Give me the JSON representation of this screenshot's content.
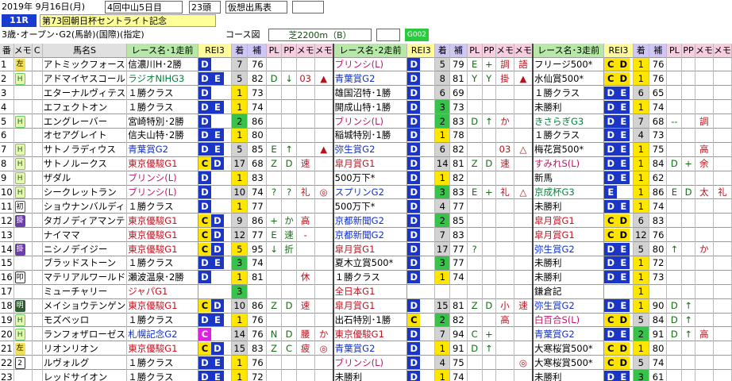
{
  "header": {
    "date": "2019年 9月16日(月)",
    "meet": "4回中山5日目",
    "runners": "23頭",
    "mode": "仮想出馬表",
    "race_no": "11R",
    "title": "第73回朝日杯セントライト記念",
    "cond": "3歳･オープン･G2(馬齢)(国際)(指定)",
    "course_label": "コース図",
    "course": "芝2200m（B）",
    "grade": "G002"
  },
  "columns": {
    "ban": "番",
    "memo": "メモ",
    "c": "C",
    "name": "馬名S",
    "r1": "レース名･1走前",
    "rc": "REI3",
    "chaku": "着",
    "ho": "補",
    "pl": "PL",
    "pp": "PP",
    "me": "メモ",
    "me2": "メモ",
    "r2": "レース名･2走前",
    "r3": "レース名･3走前"
  },
  "rows": [
    {
      "no": "1",
      "mk": "左",
      "mkc": "left",
      "name": "アトミックフォース",
      "r1": "信濃川H･2勝",
      "r1c": "rdone",
      "rc1": "D",
      "rc1b": "r3",
      "rc1e": "",
      "rk1": "7",
      "rk1c": "rkg",
      "ho1": "76",
      "pl1": "",
      "pp1": "",
      "me1a": "",
      "me1b": "",
      "r2": "ブリンシ(L)",
      "r2c": "rpink",
      "rc2": "D",
      "rc2b": "r3",
      "rk2": "5",
      "rk2c": "rkg",
      "ho2": "79",
      "pl2": "E",
      "pp2": "+",
      "me2a": "調",
      "me2b": "語",
      "r3": "フリージ500*",
      "r3c": "rdone",
      "rc3": "C",
      "rc3b": "D",
      "rk3": "1",
      "rk3c": "rk1",
      "ho3": "76",
      "pl3": "",
      "pp3": "",
      "me3a": "",
      "me3b": ""
    },
    {
      "no": "2",
      "mk": "H",
      "mkc": "h",
      "name": "アドマイヤスコール",
      "r1": "ラジオNIHG3",
      "r1c": "rgreen",
      "rc1": "D",
      "rc1b": "r3",
      "rc1e": "E",
      "rk1": "5",
      "rk1c": "rkg",
      "ho1": "82",
      "pl1": "D",
      "pp1": "↓",
      "me1a": "03",
      "me1b": "▲",
      "r2": "青葉賞G2",
      "r2c": "rblue",
      "rc2": "D",
      "rc2b": "r3",
      "rk2": "8",
      "rk2c": "rkg",
      "ho2": "81",
      "pl2": "Y",
      "pp2": "Y",
      "me2a": "掛",
      "me2b": "▲",
      "r3": "水仙賞500*",
      "r3c": "rdone",
      "rc3": "C",
      "rc3b": "D",
      "rk3": "1",
      "rk3c": "rk1",
      "ho3": "76",
      "pl3": "",
      "pp3": "",
      "me3a": "",
      "me3b": ""
    },
    {
      "no": "3",
      "mk": "",
      "mkc": "none",
      "name": "エターナルヴィテス",
      "r1": "１勝クラス",
      "r1c": "rdone",
      "rc1": "D",
      "rc1b": "r3",
      "rc1e": "",
      "rk1": "1",
      "rk1c": "rk1",
      "ho1": "73",
      "pl1": "",
      "pp1": "",
      "me1a": "",
      "me1b": "",
      "r2": "雄国沼特･1勝",
      "r2c": "rdone",
      "rc2": "D",
      "rc2b": "r3",
      "rk2": "6",
      "rk2c": "rkg",
      "ho2": "69",
      "pl2": "",
      "pp2": "",
      "me2a": "",
      "me2b": "",
      "r3": "１勝クラス",
      "r3c": "rdone",
      "rc3": "D",
      "rc3b": "E",
      "rk3": "6",
      "rk3c": "rkg",
      "ho3": "65",
      "pl3": "",
      "pp3": "",
      "me3a": "",
      "me3b": ""
    },
    {
      "no": "4",
      "mk": "",
      "mkc": "none",
      "name": "エフェクトオン",
      "r1": "１勝クラス",
      "r1c": "rdone",
      "rc1": "D",
      "rc1b": "r3",
      "rc1e": "E",
      "rk1": "1",
      "rk1c": "rk1",
      "ho1": "74",
      "pl1": "",
      "pp1": "",
      "me1a": "",
      "me1b": "",
      "r2": "開成山特･1勝",
      "r2c": "rdone",
      "rc2": "D",
      "rc2b": "r3",
      "rk2": "3",
      "rk2c": "rk3",
      "ho2": "73",
      "pl2": "",
      "pp2": "",
      "me2a": "",
      "me2b": "",
      "r3": "未勝利",
      "r3c": "rdone",
      "rc3": "D",
      "rc3b": "E",
      "rk3": "1",
      "rk3c": "rk1",
      "ho3": "74",
      "pl3": "",
      "pp3": "",
      "me3a": "",
      "me3b": ""
    },
    {
      "no": "5",
      "mk": "H",
      "mkc": "h",
      "name": "エングレーバー",
      "r1": "宮崎特別･2勝",
      "r1c": "rdone",
      "rc1": "D",
      "rc1b": "r3",
      "rc1e": "",
      "rk1": "2",
      "rk1c": "rk2",
      "ho1": "86",
      "pl1": "",
      "pp1": "",
      "me1a": "",
      "me1b": "",
      "r2": "ブリンシ(L)",
      "r2c": "rpink",
      "rc2": "D",
      "rc2b": "r3",
      "rk2": "2",
      "rk2c": "rk2",
      "ho2": "83",
      "pl2": "D",
      "pp2": "↑",
      "me2a": "か",
      "me2b": "",
      "r3": "きさらぎG3",
      "r3c": "rgreen",
      "rc3": "D",
      "rc3b": "E",
      "rk3": "7",
      "rk3c": "rkg",
      "ho3": "68",
      "pl3": "--",
      "pp3": "",
      "me3a": "調",
      "me3b": ""
    },
    {
      "no": "6",
      "mk": "",
      "mkc": "none",
      "name": "オセアグレイト",
      "r1": "信夫山特･2勝",
      "r1c": "rdone",
      "rc1": "D",
      "rc1b": "r3",
      "rc1e": "E",
      "rk1": "1",
      "rk1c": "rk1",
      "ho1": "80",
      "pl1": "",
      "pp1": "",
      "me1a": "",
      "me1b": "",
      "r2": "稲城特別･1勝",
      "r2c": "rdone",
      "rc2": "D",
      "rc2b": "r3",
      "rk2": "1",
      "rk2c": "rk1",
      "ho2": "78",
      "pl2": "",
      "pp2": "",
      "me2a": "",
      "me2b": "",
      "r3": "１勝クラス",
      "r3c": "rdone",
      "rc3": "D",
      "rc3b": "E",
      "rk3": "4",
      "rk3c": "rkg",
      "ho3": "73",
      "pl3": "",
      "pp3": "",
      "me3a": "",
      "me3b": ""
    },
    {
      "no": "7",
      "mk": "H",
      "mkc": "h",
      "name": "サトノラディウス",
      "r1": "青葉賞G2",
      "r1c": "rblue",
      "rc1": "D",
      "rc1b": "r3",
      "rc1e": "E",
      "rk1": "5",
      "rk1c": "rkg",
      "ho1": "85",
      "pl1": "E",
      "pp1": "↑",
      "me1a": "",
      "me1b": "▲",
      "r2": "弥生賞G2",
      "r2c": "rblue",
      "rc2": "D",
      "rc2b": "r3",
      "rk2": "6",
      "rk2c": "rkg",
      "ho2": "82",
      "pl2": "",
      "pp2": "",
      "me2a": "03",
      "me2b": "△",
      "r3": "梅花賞500*",
      "r3c": "rdone",
      "rc3": "D",
      "rc3b": "E",
      "rk3": "1",
      "rk3c": "rk1",
      "ho3": "75",
      "pl3": "",
      "pp3": "",
      "me3a": "高",
      "me3b": ""
    },
    {
      "no": "8",
      "mk": "H",
      "mkc": "h",
      "name": "サトノルークス",
      "r1": "東京優駿G1",
      "r1c": "rred",
      "rc1": "C",
      "rc1b": "r3y",
      "rc1e": "D",
      "rk1": "17",
      "rk1c": "rkg",
      "ho1": "68",
      "pl1": "Z",
      "pp1": "D",
      "me1a": "速",
      "me1b": "",
      "r2": "皐月賞G1",
      "r2c": "rred",
      "rc2": "D",
      "rc2b": "r3",
      "rk2": "14",
      "rk2c": "rkg",
      "ho2": "81",
      "pl2": "Z",
      "pp2": "D",
      "me2a": "速",
      "me2b": "",
      "r3": "すみれS(L)",
      "r3c": "rpink",
      "rc3": "D",
      "rc3b": "E",
      "rk3": "1",
      "rk3c": "rk1",
      "ho3": "84",
      "pl3": "D",
      "pp3": "+",
      "me3a": "余",
      "me3b": ""
    },
    {
      "no": "9",
      "mk": "H",
      "mkc": "h",
      "name": "ザダル",
      "r1": "ブリンシ(L)",
      "r1c": "rpink",
      "rc1": "D",
      "rc1b": "r3",
      "rc1e": "",
      "rk1": "1",
      "rk1c": "rk1",
      "ho1": "83",
      "pl1": "",
      "pp1": "",
      "me1a": "",
      "me1b": "",
      "r2": "500万下*",
      "r2c": "rdone",
      "rc2": "D",
      "rc2b": "r3",
      "rk2": "1",
      "rk2c": "rk1",
      "ho2": "82",
      "pl2": "",
      "pp2": "",
      "me2a": "",
      "me2b": "",
      "r3": "新馬",
      "r3c": "rdone",
      "rc3": "D",
      "rc3b": "E",
      "rk3": "1",
      "rk3c": "rk1",
      "ho3": "62",
      "pl3": "",
      "pp3": "",
      "me3a": "",
      "me3b": ""
    },
    {
      "no": "10",
      "mk": "H",
      "mkc": "h",
      "name": "シークレットラン",
      "r1": "ブリンシ(L)",
      "r1c": "rpink",
      "rc1": "D",
      "rc1b": "r3",
      "rc1e": "",
      "rk1": "10",
      "rk1c": "rkg",
      "ho1": "74",
      "pl1": "?",
      "pp1": "?",
      "me1a": "礼",
      "me1b": "◎",
      "r2": "スプリンG2",
      "r2c": "rblue",
      "rc2": "D",
      "rc2b": "r3",
      "rk2": "3",
      "rk2c": "rk3",
      "ho2": "83",
      "pl2": "E",
      "pp2": "+",
      "me2a": "礼",
      "me2b": "△",
      "r3": "京成杯G3",
      "r3c": "rgreen",
      "rc3": "E",
      "rc3b": "",
      "rk3": "1",
      "rk3c": "rk1",
      "ho3": "86",
      "pl3": "E",
      "pp3": "D",
      "me3a": "太",
      "me3b": "礼"
    },
    {
      "no": "11",
      "mk": "初",
      "mkc": "first",
      "name": "ショウナンバルディ",
      "r1": "１勝クラス",
      "r1c": "rdone",
      "rc1": "D",
      "rc1b": "r3",
      "rc1e": "",
      "rk1": "1",
      "rk1c": "rk1",
      "ho1": "77",
      "pl1": "",
      "pp1": "",
      "me1a": "",
      "me1b": "",
      "r2": "500万下*",
      "r2c": "rdone",
      "rc2": "D",
      "rc2b": "r3",
      "rk2": "4",
      "rk2c": "rkg",
      "ho2": "77",
      "pl2": "",
      "pp2": "",
      "me2a": "",
      "me2b": "",
      "r3": "未勝利",
      "r3c": "rdone",
      "rc3": "D",
      "rc3b": "E",
      "rk3": "1",
      "rk3c": "rk1",
      "ho3": "74",
      "pl3": "",
      "pp3": "",
      "me3a": "",
      "me3b": ""
    },
    {
      "no": "12",
      "mk": "掛",
      "mkc": "block",
      "name": "タガノディアマンテ",
      "r1": "東京優駿G1",
      "r1c": "rred",
      "rc1": "C",
      "rc1b": "r3y",
      "rc1e": "D",
      "rk1": "9",
      "rk1c": "rkg",
      "ho1": "86",
      "pl1": "+",
      "pp1": "か",
      "me1a": "高",
      "me1b": "",
      "r2": "京都新聞G2",
      "r2c": "rblue",
      "rc2": "D",
      "rc2b": "r3",
      "rk2": "2",
      "rk2c": "rk2",
      "ho2": "85",
      "pl2": "",
      "pp2": "",
      "me2a": "",
      "me2b": "",
      "r3": "皐月賞G1",
      "r3c": "rred",
      "rc3": "C",
      "rc3b": "D",
      "rk3": "6",
      "rk3c": "rkg",
      "ho3": "83",
      "pl3": "",
      "pp3": "",
      "me3a": "",
      "me3b": ""
    },
    {
      "no": "13",
      "mk": "",
      "mkc": "none",
      "name": "ナイママ",
      "r1": "東京優駿G1",
      "r1c": "rred",
      "rc1": "C",
      "rc1b": "r3y",
      "rc1e": "D",
      "rk1": "12",
      "rk1c": "rkg",
      "ho1": "77",
      "pl1": "E",
      "pp1": "速",
      "me1a": "-",
      "me1b": "",
      "r2": "京都新聞G2",
      "r2c": "rblue",
      "rc2": "D",
      "rc2b": "r3",
      "rk2": "7",
      "rk2c": "rkg",
      "ho2": "83",
      "pl2": "",
      "pp2": "",
      "me2a": "",
      "me2b": "",
      "r3": "皐月賞G1",
      "r3c": "rred",
      "rc3": "C",
      "rc3b": "D",
      "rk3": "12",
      "rk3c": "rkg",
      "ho3": "76",
      "pl3": "",
      "pp3": "",
      "me3a": "",
      "me3b": ""
    },
    {
      "no": "14",
      "mk": "掛",
      "mkc": "block",
      "name": "ニシノデイジー",
      "r1": "東京優駿G1",
      "r1c": "rred",
      "rc1": "C",
      "rc1b": "r3y",
      "rc1e": "D",
      "rk1": "5",
      "rk1c": "rk1",
      "ho1": "95",
      "pl1": "↓",
      "pp1": "折",
      "me1a": "",
      "me1b": "",
      "r2": "皐月賞G1",
      "r2c": "rred",
      "rc2": "D",
      "rc2b": "r3",
      "rk2": "17",
      "rk2c": "rkg",
      "ho2": "77",
      "pl2": "?",
      "pp2": "",
      "me2a": "",
      "me2b": "",
      "r3": "弥生賞G2",
      "r3c": "rblue",
      "rc3": "D",
      "rc3b": "E",
      "rk3": "5",
      "rk3c": "rkg",
      "ho3": "80",
      "pl3": "↑",
      "pp3": "",
      "me3a": "か",
      "me3b": ""
    },
    {
      "no": "15",
      "mk": "",
      "mkc": "none",
      "name": "ブラッドストーン",
      "r1": "１勝クラス",
      "r1c": "rdone",
      "rc1": "D",
      "rc1b": "r3",
      "rc1e": "E",
      "rk1": "3",
      "rk1c": "rk3",
      "ho1": "74",
      "pl1": "",
      "pp1": "",
      "me1a": "",
      "me1b": "",
      "r2": "夏木立賞500*",
      "r2c": "rdone",
      "rc2": "D",
      "rc2b": "r3",
      "rk2": "3",
      "rk2c": "rk3",
      "ho2": "77",
      "pl2": "",
      "pp2": "",
      "me2a": "",
      "me2b": "",
      "r3": "未勝利",
      "r3c": "rdone",
      "rc3": "D",
      "rc3b": "E",
      "rk3": "1",
      "rk3c": "rk1",
      "ho3": "72",
      "pl3": "",
      "pp3": "",
      "me3a": "",
      "me3b": ""
    },
    {
      "no": "16",
      "mk": "叩",
      "mkc": "ttl",
      "name": "マテリアルワールド",
      "r1": "瀬波温泉･2勝",
      "r1c": "rdone",
      "rc1": "D",
      "rc1b": "r3",
      "rc1e": "",
      "rk1": "1",
      "rk1c": "rk1",
      "ho1": "81",
      "pl1": "",
      "pp1": "",
      "me1a": "休",
      "me1b": "",
      "r2": "１勝クラス",
      "r2c": "rdone",
      "rc2": "D",
      "rc2b": "r3",
      "rk2": "1",
      "rk2c": "rk1",
      "ho2": "74",
      "pl2": "",
      "pp2": "",
      "me2a": "",
      "me2b": "",
      "r3": "未勝利",
      "r3c": "rdone",
      "rc3": "D",
      "rc3b": "E",
      "rk3": "1",
      "rk3c": "rk1",
      "ho3": "73",
      "pl3": "",
      "pp3": "",
      "me3a": "",
      "me3b": ""
    },
    {
      "no": "17",
      "mk": "",
      "mkc": "none",
      "name": "ミューチャリー",
      "r1": "ジャパG1",
      "r1c": "rred",
      "rc1": "",
      "rc1b": "",
      "rc1e": "",
      "rk1": "3",
      "rk1c": "rk3",
      "ho1": "",
      "pl1": "",
      "pp1": "",
      "me1a": "",
      "me1b": "",
      "r2": "全日本G1",
      "r2c": "rred",
      "rc2": "",
      "rc2b": "",
      "rk2": "",
      "rk2c": "",
      "ho2": "",
      "pl2": "",
      "pp2": "",
      "me2a": "",
      "me2b": "",
      "r3": "鎌倉記",
      "r3c": "rdone",
      "rc3": "",
      "rc3b": "",
      "rk3": "1",
      "rk3c": "rk1",
      "ho3": "",
      "pl3": "",
      "pp3": "",
      "me3a": "",
      "me3b": ""
    },
    {
      "no": "18",
      "mk": "明",
      "mkc": "blinker",
      "name": "メイショウテンゲン",
      "r1": "東京優駿G1",
      "r1c": "rred",
      "rc1": "C",
      "rc1b": "r3y",
      "rc1e": "D",
      "rk1": "10",
      "rk1c": "rkg",
      "ho1": "86",
      "pl1": "Z",
      "pp1": "D",
      "me1a": "速",
      "me1b": "",
      "r2": "皐月賞G1",
      "r2c": "rred",
      "rc2": "D",
      "rc2b": "r3",
      "rk2": "15",
      "rk2c": "rkg",
      "ho2": "81",
      "pl2": "Z",
      "pp2": "D",
      "me2a": "小",
      "me2b": "速",
      "r3": "弥生賞G2",
      "r3c": "rblue",
      "rc3": "D",
      "rc3b": "E",
      "rk3": "1",
      "rk3c": "rk1",
      "ho3": "90",
      "pl3": "D",
      "pp3": "↑",
      "me3a": "",
      "me3b": ""
    },
    {
      "no": "19",
      "mk": "H",
      "mkc": "h",
      "name": "モズベッロ",
      "r1": "１勝クラス",
      "r1c": "rdone",
      "rc1": "D",
      "rc1b": "r3",
      "rc1e": "E",
      "rk1": "1",
      "rk1c": "rk1",
      "ho1": "76",
      "pl1": "",
      "pp1": "",
      "me1a": "",
      "me1b": "",
      "r2": "出石特別･1勝",
      "r2c": "rdone",
      "rc2": "C",
      "rc2b": "r3y",
      "rk2": "2",
      "rk2c": "rk2",
      "ho2": "82",
      "pl2": "",
      "pp2": "",
      "me2a": "高",
      "me2b": "",
      "r3": "白百合S(L)",
      "r3c": "rpink",
      "rc3": "C",
      "rc3b": "D",
      "rk3": "5",
      "rk3c": "rkg",
      "ho3": "84",
      "pl3": "D",
      "pp3": "↑",
      "me3a": "",
      "me3b": ""
    },
    {
      "no": "20",
      "mk": "H",
      "mkc": "h",
      "name": "ランフォザローゼス",
      "r1": "札幌記念G2",
      "r1c": "rblue",
      "rc1": "C",
      "rc1b": "r3p",
      "rc1e": "",
      "rk1": "14",
      "rk1c": "rkg",
      "ho1": "76",
      "pl1": "N",
      "pp1": "D",
      "me1a": "腰",
      "me1b": "か",
      "r2": "東京優駿G1",
      "r2c": "rred",
      "rc2": "D",
      "rc2b": "r3",
      "rk2": "7",
      "rk2c": "rkg",
      "ho2": "94",
      "pl2": "C",
      "pp2": "+",
      "me2a": "",
      "me2b": "",
      "r3": "青葉賞G2",
      "r3c": "rblue",
      "rc3": "D",
      "rc3b": "E",
      "rk3": "2",
      "rk3c": "rk2",
      "ho3": "91",
      "pl3": "D",
      "pp3": "↑",
      "me3a": "高",
      "me3b": ""
    },
    {
      "no": "21",
      "mk": "左",
      "mkc": "left",
      "name": "リオンリオン",
      "r1": "東京優駿G1",
      "r1c": "rred",
      "rc1": "C",
      "rc1b": "r3y",
      "rc1e": "D",
      "rk1": "15",
      "rk1c": "rkg",
      "ho1": "83",
      "pl1": "Z",
      "pp1": "C",
      "me1a": "疲",
      "me1b": "◎",
      "r2": "青葉賞G2",
      "r2c": "rblue",
      "rc2": "D",
      "rc2b": "r3",
      "rk2": "1",
      "rk2c": "rk1",
      "ho2": "91",
      "pl2": "D",
      "pp2": "↑",
      "me2a": "",
      "me2b": "",
      "r3": "大寒桜賞500*",
      "r3c": "rdone",
      "rc3": "C",
      "rc3b": "D",
      "rk3": "1",
      "rk3c": "rk1",
      "ho3": "80",
      "pl3": "",
      "pp3": "",
      "me3a": "",
      "me3b": ""
    },
    {
      "no": "22",
      "mk": "2",
      "mkc": "ttl",
      "name": "ルヴォルグ",
      "r1": "１勝クラス",
      "r1c": "rdone",
      "rc1": "D",
      "rc1b": "r3",
      "rc1e": "E",
      "rk1": "1",
      "rk1c": "rk1",
      "ho1": "76",
      "pl1": "",
      "pp1": "",
      "me1a": "",
      "me1b": "",
      "r2": "ブリンシ(L)",
      "r2c": "rpink",
      "rc2": "D",
      "rc2b": "r3",
      "rk2": "4",
      "rk2c": "rkg",
      "ho2": "75",
      "pl2": "",
      "pp2": "",
      "me2a": "",
      "me2b": "◎",
      "r3": "大寒桜賞500*",
      "r3c": "rdone",
      "rc3": "C",
      "rc3b": "D",
      "rk3": "5",
      "rk3c": "rkg",
      "ho3": "74",
      "pl3": "",
      "pp3": "",
      "me3a": "",
      "me3b": ""
    },
    {
      "no": "23",
      "mk": "",
      "mkc": "none",
      "name": "レッドサイオン",
      "r1": "１勝クラス",
      "r1c": "rdone",
      "rc1": "D",
      "rc1b": "r3",
      "rc1e": "E",
      "rk1": "1",
      "rk1c": "rk1",
      "ho1": "72",
      "pl1": "",
      "pp1": "",
      "me1a": "",
      "me1b": "",
      "r2": "未勝利",
      "r2c": "rdone",
      "rc2": "D",
      "rc2b": "r3",
      "rk2": "1",
      "rk2c": "rk1",
      "ho2": "74",
      "pl2": "",
      "pp2": "",
      "me2a": "",
      "me2b": "",
      "r3": "未勝利",
      "r3c": "rdone",
      "rc3": "D",
      "rc3b": "E",
      "rk3": "3",
      "rk3c": "rk3",
      "ho3": "61",
      "pl3": "",
      "pp3": "",
      "me3a": "",
      "me3b": ""
    }
  ]
}
